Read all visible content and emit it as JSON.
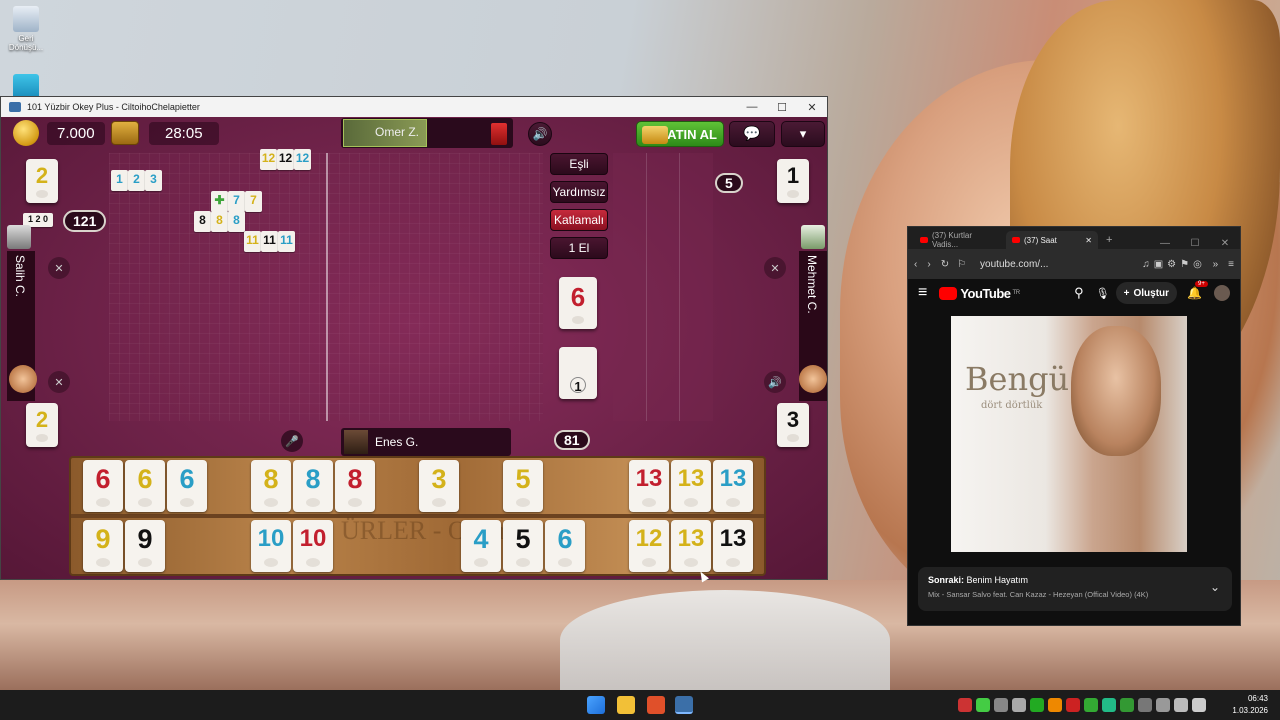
{
  "desktop": {
    "recycle_label": "Geri Dönüşü...",
    "icon2_label": ""
  },
  "game_window": {
    "title": "101 Yüzbir Okey Plus - CiltoihoChelapietter",
    "minimize": "—",
    "maximize": "☐",
    "close": "✕",
    "coins": "7.000",
    "timer": "28:05",
    "buy_label": "SATIN AL",
    "opponents": {
      "top": {
        "name": "Omer Z."
      },
      "left": {
        "name": "Salih C.",
        "tile": "2",
        "score": "121",
        "tile_bottom": "2"
      },
      "right": {
        "name": "Mehmet C.",
        "tile": "1",
        "count": "5",
        "tile_bottom": "3"
      }
    },
    "modes": [
      "Eşli",
      "Yardımsız",
      "Katlamalı",
      "1 El"
    ],
    "indicator_tile": "6",
    "deck_tile": "1",
    "deck_count": "81",
    "me": {
      "name": "Enes G."
    },
    "left_meld_label": "1 2 0",
    "table_melds": [
      {
        "id": "m1",
        "tiles": [
          {
            "v": "1",
            "c": "blue"
          },
          {
            "v": "2",
            "c": "blue"
          },
          {
            "v": "3",
            "c": "blue"
          }
        ]
      },
      {
        "id": "m2",
        "tiles": [
          {
            "v": "12",
            "c": "yellow"
          },
          {
            "v": "12",
            "c": "black"
          },
          {
            "v": "12",
            "c": "blue"
          }
        ]
      },
      {
        "id": "m3",
        "tiles": [
          {
            "v": "✚",
            "c": "green"
          },
          {
            "v": "7",
            "c": "blue"
          },
          {
            "v": "7",
            "c": "yellow"
          }
        ]
      },
      {
        "id": "m4",
        "tiles": [
          {
            "v": "8",
            "c": "black"
          },
          {
            "v": "8",
            "c": "yellow"
          },
          {
            "v": "8",
            "c": "blue"
          }
        ]
      },
      {
        "id": "m5",
        "tiles": [
          {
            "v": "11",
            "c": "yellow"
          },
          {
            "v": "11",
            "c": "black"
          },
          {
            "v": "11",
            "c": "blue"
          }
        ]
      }
    ],
    "rack_top": [
      {
        "v": "6",
        "c": "red"
      },
      {
        "v": "6",
        "c": "yellow"
      },
      {
        "v": "6",
        "c": "blue"
      },
      {
        "v": "8",
        "c": "yellow"
      },
      {
        "v": "8",
        "c": "blue"
      },
      {
        "v": "8",
        "c": "red"
      },
      {
        "v": "3",
        "c": "yellow"
      },
      {
        "v": "5",
        "c": "yellow"
      },
      {
        "v": "13",
        "c": "red"
      },
      {
        "v": "13",
        "c": "yellow"
      },
      {
        "v": "13",
        "c": "blue"
      }
    ],
    "rack_bottom": [
      {
        "v": "9",
        "c": "yellow"
      },
      {
        "v": "9",
        "c": "black"
      },
      {
        "v": "10",
        "c": "blue"
      },
      {
        "v": "10",
        "c": "red"
      },
      {
        "v": "4",
        "c": "blue"
      },
      {
        "v": "5",
        "c": "black"
      },
      {
        "v": "6",
        "c": "blue"
      },
      {
        "v": "12",
        "c": "yellow"
      },
      {
        "v": "13",
        "c": "yellow"
      },
      {
        "v": "13",
        "c": "black"
      }
    ],
    "rack_watermark": "ÜRLER - Omer"
  },
  "browser": {
    "tab1": "(37) Kurtlar Vadis...",
    "tab2": "(37) Saat",
    "tab_close": "✕",
    "new_tab": "+",
    "url": "youtube.com/...",
    "yt_logo": "YouTube",
    "yt_country": "TR",
    "create_label": "Oluştur",
    "notif_badge": "9+",
    "video_title": "Bengü",
    "video_subtitle": "dört dörtlük",
    "next_label": "Sonraki:",
    "next_title": "Benim Hayatım",
    "next_mix": "Mix - Sansar Salvo feat. Can Kazaz - Hezeyan (Offical Video) (4K)"
  },
  "taskbar": {
    "time": "06:43",
    "date": "1.03.2026"
  },
  "colors": {
    "red": "#c21f2e",
    "yellow": "#d4b21a",
    "blue": "#2a9ec6",
    "black": "#111111",
    "green": "#3ea43a"
  }
}
